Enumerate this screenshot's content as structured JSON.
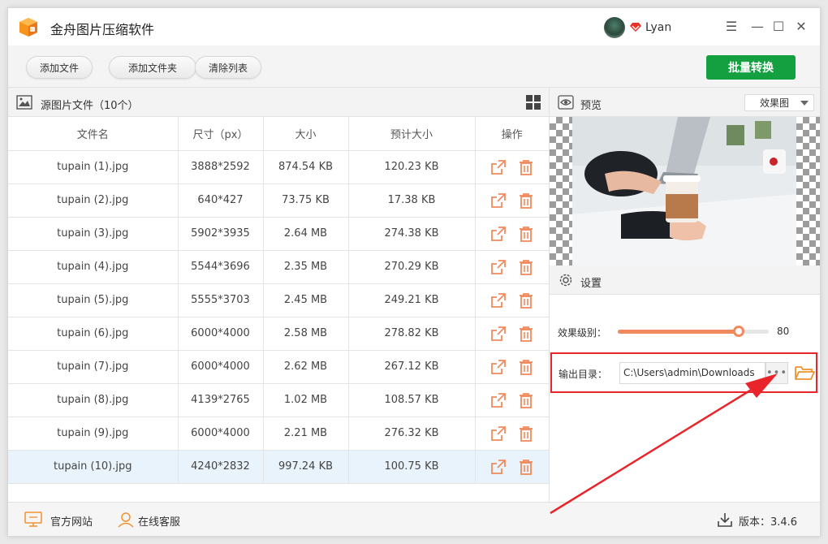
{
  "app": {
    "title": "金舟图片压缩软件",
    "username": "Lyan"
  },
  "window_controls": {
    "menu": "☰",
    "minimize": "—",
    "maximize": "☐",
    "close": "✕"
  },
  "toolbar": {
    "add_file": "添加文件",
    "add_folder": "添加文件夹",
    "clear_list": "清除列表",
    "batch_convert": "批量转换"
  },
  "file_list": {
    "title": "源图片文件（10个）",
    "columns": [
      "文件名",
      "尺寸（px）",
      "大小",
      "预计大小",
      "操作"
    ],
    "rows": [
      {
        "name": "tupain (1).jpg",
        "dims": "3888*2592",
        "size": "874.54 KB",
        "estimated": "120.23 KB"
      },
      {
        "name": "tupain (2).jpg",
        "dims": "640*427",
        "size": "73.75 KB",
        "estimated": "17.38 KB"
      },
      {
        "name": "tupain (3).jpg",
        "dims": "5902*3935",
        "size": "2.64 MB",
        "estimated": "274.38 KB"
      },
      {
        "name": "tupain (4).jpg",
        "dims": "5544*3696",
        "size": "2.35 MB",
        "estimated": "270.29 KB"
      },
      {
        "name": "tupain (5).jpg",
        "dims": "5555*3703",
        "size": "2.45 MB",
        "estimated": "249.21 KB"
      },
      {
        "name": "tupain (6).jpg",
        "dims": "6000*4000",
        "size": "2.58 MB",
        "estimated": "278.82 KB"
      },
      {
        "name": "tupain (7).jpg",
        "dims": "6000*4000",
        "size": "2.62 MB",
        "estimated": "267.12 KB"
      },
      {
        "name": "tupain (8).jpg",
        "dims": "4139*2765",
        "size": "1.02 MB",
        "estimated": "108.57 KB"
      },
      {
        "name": "tupain (9).jpg",
        "dims": "6000*4000",
        "size": "2.21 MB",
        "estimated": "276.32 KB"
      },
      {
        "name": "tupain (10).jpg",
        "dims": "4240*2832",
        "size": "997.24 KB",
        "estimated": "100.75 KB"
      }
    ],
    "selected_index": 9
  },
  "preview": {
    "title": "预览",
    "mode": "效果图"
  },
  "settings": {
    "title": "设置",
    "level_label": "效果级别：",
    "level_value": 80,
    "output_label": "输出目录：",
    "output_path": "C:\\Users\\admin\\Downloads",
    "browse_label": "•••"
  },
  "status": {
    "website": "官方网站",
    "support": "在线客服",
    "version": "版本：3.4.6"
  },
  "colors": {
    "accent_orange": "#f08a5d",
    "convert_green": "#14a040",
    "highlight_red": "#e8252a",
    "selected_row": "#e9f3fb"
  }
}
